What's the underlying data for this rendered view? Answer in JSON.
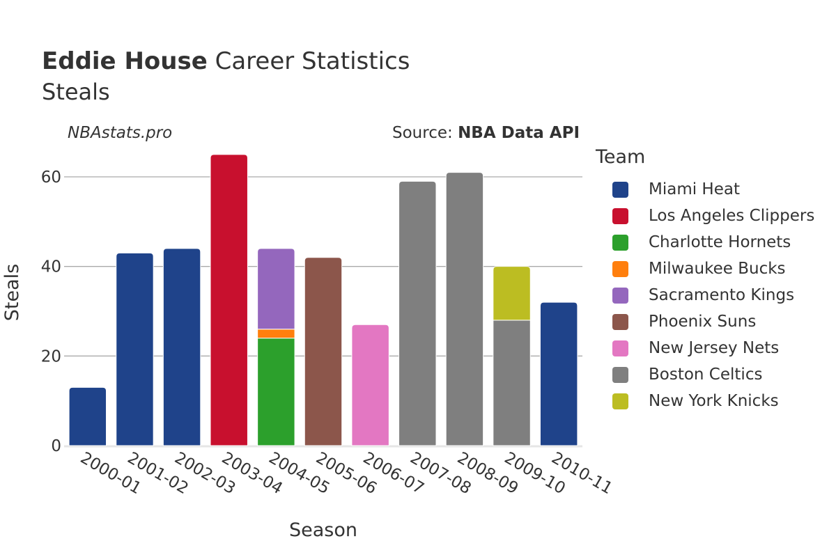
{
  "header": {
    "title_bold": "Eddie House",
    "title_rest": " Career Statistics",
    "subtitle": "Steals",
    "brand": "NBAstats.pro",
    "source_prefix": "Source: ",
    "source_bold": "NBA Data API"
  },
  "legend": {
    "title": "Team",
    "items": [
      {
        "label": "Miami Heat",
        "color": "#1f438a"
      },
      {
        "label": "Los Angeles Clippers",
        "color": "#c8102e"
      },
      {
        "label": "Charlotte Hornets",
        "color": "#2ca02c"
      },
      {
        "label": "Milwaukee Bucks",
        "color": "#ff7f0e"
      },
      {
        "label": "Sacramento Kings",
        "color": "#9467bd"
      },
      {
        "label": "Phoenix Suns",
        "color": "#8c564b"
      },
      {
        "label": "New Jersey Nets",
        "color": "#e377c2"
      },
      {
        "label": "Boston Celtics",
        "color": "#7f7f7f"
      },
      {
        "label": "New York Knicks",
        "color": "#bcbd22"
      }
    ]
  },
  "chart_data": {
    "type": "bar",
    "stacked": true,
    "title": "Eddie House Career Statistics",
    "subtitle": "Steals",
    "xlabel": "Season",
    "ylabel": "Steals",
    "ylim": [
      0,
      68
    ],
    "yticks": [
      0,
      20,
      40,
      60
    ],
    "grid": true,
    "legend_position": "right",
    "categories": [
      "2000-01",
      "2001-02",
      "2002-03",
      "2003-04",
      "2004-05",
      "2005-06",
      "2006-07",
      "2007-08",
      "2008-09",
      "2009-10",
      "2010-11"
    ],
    "series": [
      {
        "name": "Miami Heat",
        "color": "#1f438a",
        "values": [
          13,
          43,
          44,
          0,
          0,
          0,
          0,
          0,
          0,
          0,
          32
        ]
      },
      {
        "name": "Los Angeles Clippers",
        "color": "#c8102e",
        "values": [
          0,
          0,
          0,
          65,
          0,
          0,
          0,
          0,
          0,
          0,
          0
        ]
      },
      {
        "name": "Charlotte Hornets",
        "color": "#2ca02c",
        "values": [
          0,
          0,
          0,
          0,
          24,
          0,
          0,
          0,
          0,
          0,
          0
        ]
      },
      {
        "name": "Milwaukee Bucks",
        "color": "#ff7f0e",
        "values": [
          0,
          0,
          0,
          0,
          2,
          0,
          0,
          0,
          0,
          0,
          0
        ]
      },
      {
        "name": "Sacramento Kings",
        "color": "#9467bd",
        "values": [
          0,
          0,
          0,
          0,
          18,
          0,
          0,
          0,
          0,
          0,
          0
        ]
      },
      {
        "name": "Phoenix Suns",
        "color": "#8c564b",
        "values": [
          0,
          0,
          0,
          0,
          0,
          42,
          0,
          0,
          0,
          0,
          0
        ]
      },
      {
        "name": "New Jersey Nets",
        "color": "#e377c2",
        "values": [
          0,
          0,
          0,
          0,
          0,
          0,
          27,
          0,
          0,
          0,
          0
        ]
      },
      {
        "name": "Boston Celtics",
        "color": "#7f7f7f",
        "values": [
          0,
          0,
          0,
          0,
          0,
          0,
          0,
          59,
          61,
          28,
          0
        ]
      },
      {
        "name": "New York Knicks",
        "color": "#bcbd22",
        "values": [
          0,
          0,
          0,
          0,
          0,
          0,
          0,
          0,
          0,
          12,
          0
        ]
      }
    ]
  }
}
